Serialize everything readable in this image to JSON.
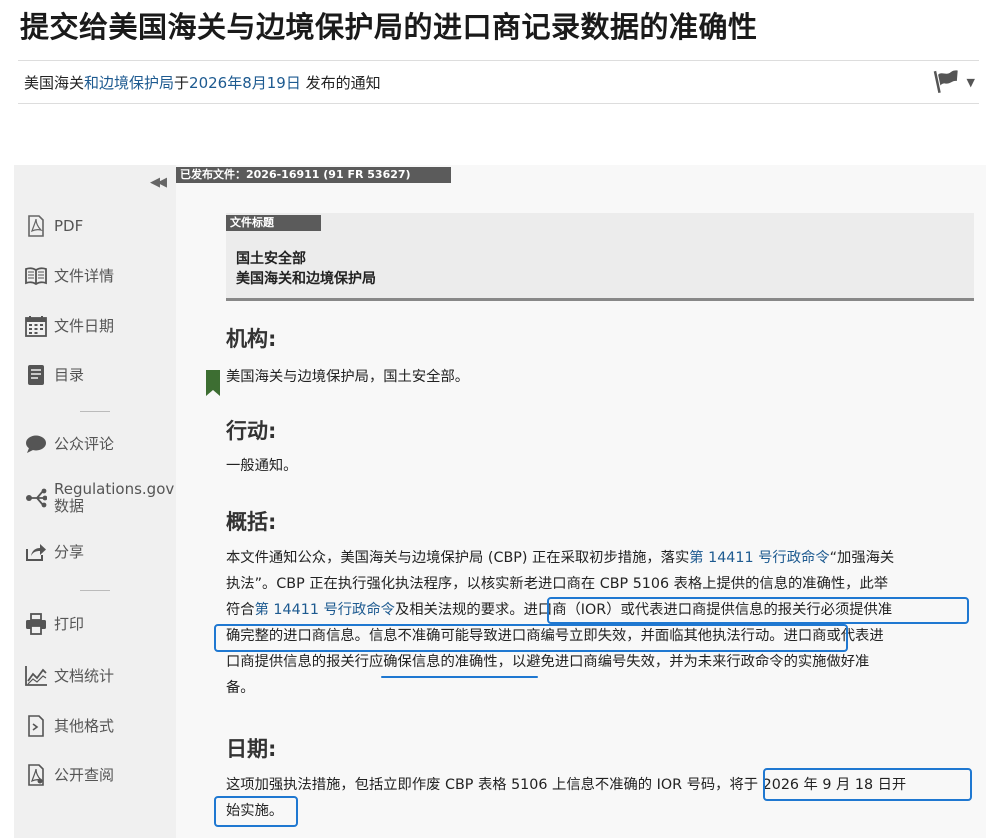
{
  "header": {
    "title": "提交给美国海关与边境保护局的进口商记录数据的准确性",
    "pub_prefix": "美国海关",
    "pub_agency_link": "和边境保护局",
    "pub_mid": "于",
    "pub_date_link": "2026年8月19日",
    "pub_suffix": " 发布的通知"
  },
  "sidebar": {
    "collapse_glyph": "◀◀",
    "items": [
      {
        "label": "PDF",
        "icon": "pdf-icon"
      },
      {
        "label": "文件详情",
        "icon": "book-icon"
      },
      {
        "label": "文件日期",
        "icon": "calendar-icon"
      },
      {
        "label": "目录",
        "icon": "toc-icon"
      },
      {
        "label": "公众评论",
        "icon": "comment-icon"
      },
      {
        "label": "Regulations.gov",
        "label2": "数据",
        "icon": "share-nodes-icon"
      },
      {
        "label": "分享",
        "icon": "share-icon"
      },
      {
        "label": "打印",
        "icon": "print-icon"
      },
      {
        "label": "文档统计",
        "icon": "stats-icon"
      },
      {
        "label": "其他格式",
        "icon": "other-formats-icon"
      },
      {
        "label": "公开查阅",
        "icon": "public-inspection-icon"
      }
    ]
  },
  "document": {
    "doc_tag": "已发布文件：2026-16911 (91 FR 53627)",
    "title_tag": "文件标题",
    "agency_1": "国土安全部",
    "agency_2": "美国海关和边境保护局",
    "agency_heading": "机构:",
    "agency_text": "美国海关与边境保护局，国土安全部。",
    "action_heading": "行动:",
    "action_text": "一般通知。",
    "summary_heading": "概括:",
    "summary": {
      "l1_a": "本文件通知公众，美国海关与边境保护局 (CBP) 正在采取初步措施，落实",
      "l1_link": "第 14411 号行政命令",
      "l1_b": "“加强海关",
      "l2": "执法”。CBP 正在执行强化执法程序，以核实新老进口商在 CBP 5106 表格上提供的信息的准确性，此举",
      "l3_a": "符合",
      "l3_link": "第 14411 号行政命令",
      "l3_b": "及相关法规的要求。",
      "l3_c": "进口商（IOR）或代表进口商提供信息的报关行必须提供准",
      "l4_a": "确完整的进口商信息。信息不准确可能导致进口商编号立即失效，并面临其他执法行动。",
      "l4_b": "进口商或代表进",
      "l5": "口商提供信息的报关行应确保信息的准确性，以避免进口商编号失效，并为未来行政命令的实施做好准",
      "l6": "备。"
    },
    "dates_heading": "日期:",
    "dates": {
      "l1_a": "这项加强执法措施，包括立即作废 CBP 表格 5106 上信息不准确的 IOR 号码，",
      "l1_b": "将于 2026 年 9 月 18 日开",
      "l2": "始实施。"
    }
  },
  "colors": {
    "link": "#1d5a90",
    "highlight": "#1f78d1",
    "sidebar_bg": "#f0f0f0",
    "tag_bg": "#5b5b5b"
  }
}
